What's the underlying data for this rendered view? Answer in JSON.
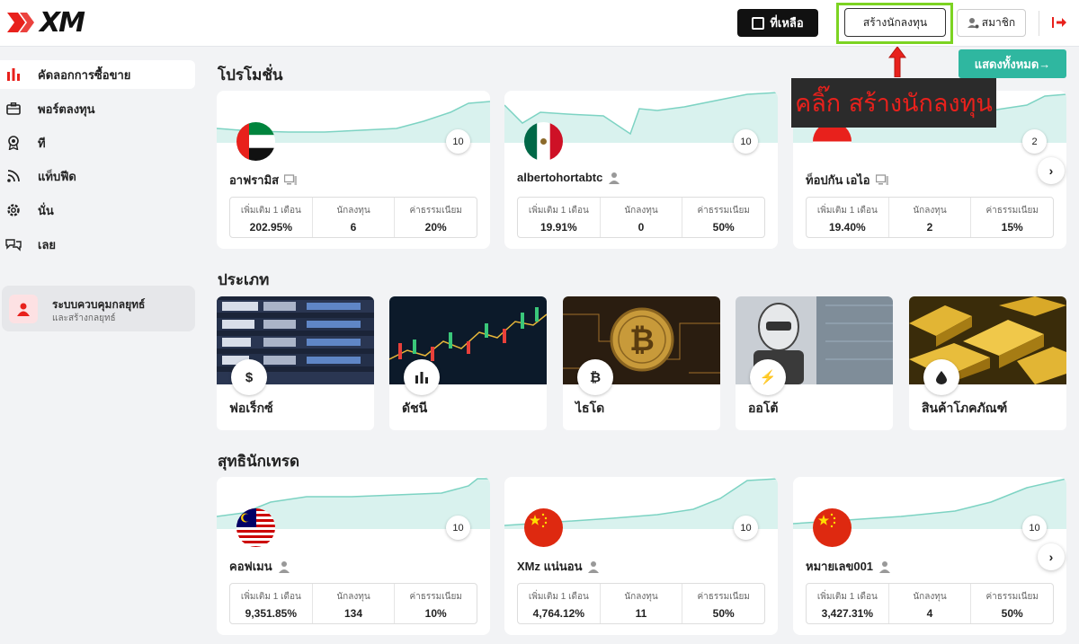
{
  "header": {
    "logo": "XM",
    "balance_label": "ที่เหลือ",
    "create_investor_label": "สร้างนักลงทุน",
    "member_label": "สมาชิก"
  },
  "sidebar": {
    "items": [
      {
        "label": "คัดลอกการซื้อขาย",
        "icon": "bar-chart-icon"
      },
      {
        "label": "พอร์ตลงทุน",
        "icon": "briefcase-icon"
      },
      {
        "label": "ที",
        "icon": "award-icon"
      },
      {
        "label": "แท็บฟีด",
        "icon": "rss-icon"
      },
      {
        "label": "นั่น",
        "icon": "gear-icon"
      },
      {
        "label": "เลย",
        "icon": "chat-icon"
      }
    ],
    "strategy": {
      "title": "ระบบควบคุมกลยุทธ์",
      "subtitle": "และสร้างกลยุทธ์"
    }
  },
  "sections": {
    "promotions": "โปรโมชั่น",
    "categories": "ประเภท",
    "top_traders": "สุทธินักเทรด"
  },
  "show_all_label": "แสดงทั้งหมด→",
  "callout_text": "คลิ๊ก สร้างนักลงทุน",
  "stat_labels": {
    "growth": "เพิ่มเติม 1 เดือน",
    "investors": "นักลงทุน",
    "fee": "ค่าธรรมเนียม"
  },
  "promotions": [
    {
      "name": "อาฟรามิส",
      "flag": "uae",
      "badge": "10",
      "user_icon": "monitor-icon",
      "growth": "202.95%",
      "investors": "6",
      "fee": "20%"
    },
    {
      "name": "albertohortabtc",
      "flag": "mexico",
      "badge": "10",
      "user_icon": "user-icon",
      "growth": "19.91%",
      "investors": "0",
      "fee": "50%"
    },
    {
      "name": "ท็อปกัน เอไอ",
      "flag": "indonesia",
      "badge": "2",
      "user_icon": "monitor-icon",
      "growth": "19.40%",
      "investors": "2",
      "fee": "15%"
    }
  ],
  "categories": [
    {
      "label": "ฟอเร็กซ์",
      "icon": "dollar-icon",
      "glyph": "$"
    },
    {
      "label": "ดัชนี",
      "icon": "bar-chart-icon",
      "glyph": ""
    },
    {
      "label": "ไธโด",
      "icon": "bitcoin-icon",
      "glyph": "₿"
    },
    {
      "label": "ออโต้",
      "icon": "lightning-icon",
      "glyph": "⚡"
    },
    {
      "label": "สินค้าโภคภัณฑ์",
      "icon": "drop-icon",
      "glyph": ""
    }
  ],
  "top_traders": [
    {
      "name": "คอฟเมน",
      "flag": "malaysia",
      "badge": "10",
      "user_icon": "user-icon",
      "growth": "9,351.85%",
      "investors": "134",
      "fee": "10%"
    },
    {
      "name": "XMz แน่นอน",
      "flag": "china",
      "badge": "10",
      "user_icon": "user-icon",
      "growth": "4,764.12%",
      "investors": "11",
      "fee": "50%"
    },
    {
      "name": "หมายเลข001",
      "flag": "china",
      "badge": "10",
      "user_icon": "user-icon",
      "growth": "3,427.31%",
      "investors": "4",
      "fee": "50%"
    }
  ],
  "colors": {
    "accent": "#2fb7a0",
    "brand_red": "#e8211c",
    "highlight": "#7cd322"
  }
}
